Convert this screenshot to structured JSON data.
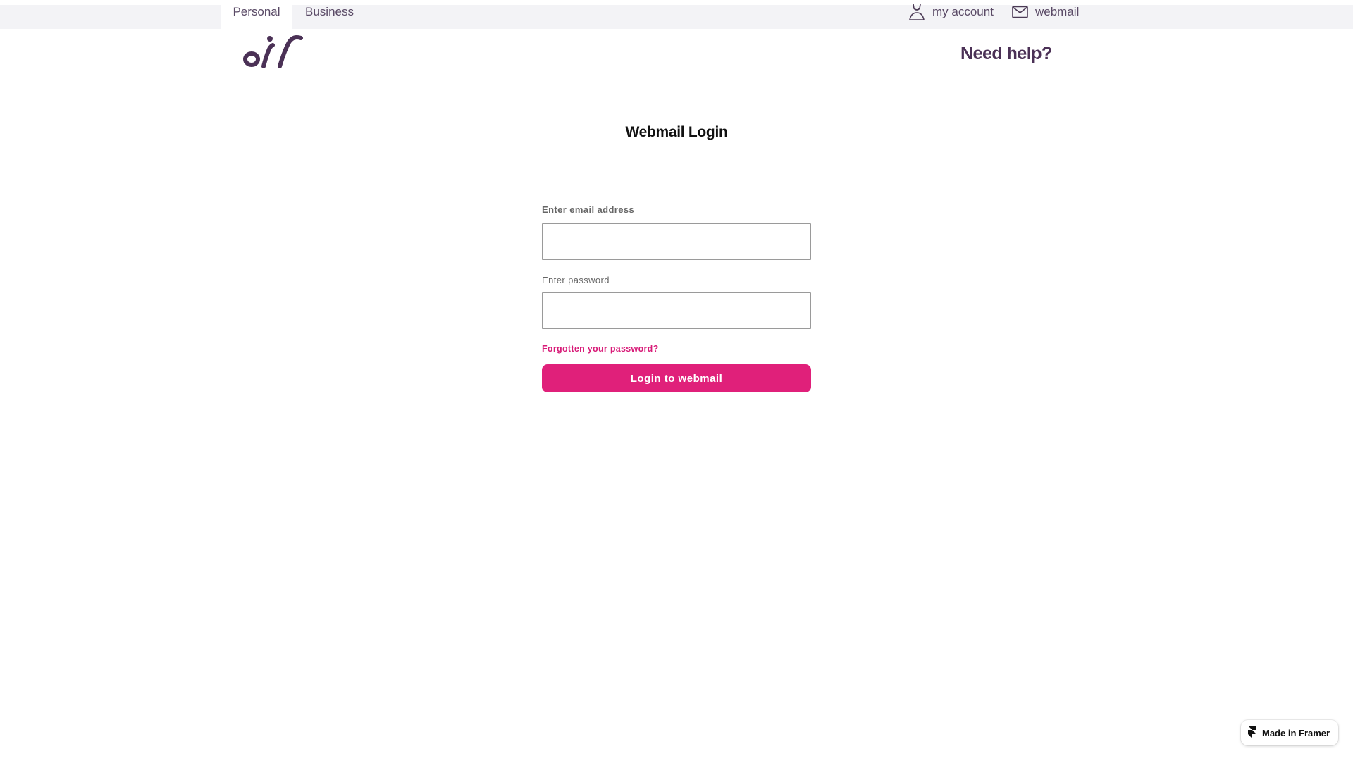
{
  "top_nav": {
    "tabs": [
      {
        "label": "Personal",
        "active": true
      },
      {
        "label": "Business",
        "active": false
      }
    ],
    "my_account_label": "my account",
    "webmail_label": "webmail",
    "icons": [
      "person-icon",
      "mail-icon"
    ]
  },
  "header": {
    "logo_icon": "eir-logo",
    "need_help_label": "Need help?"
  },
  "main": {
    "title": "Webmail Login",
    "email_label": "Enter email address",
    "email_value": "",
    "password_label": "Enter password",
    "password_value": "",
    "forgot_password_label": "Forgotten your password?",
    "login_button_label": "Login to webmail"
  },
  "badge": {
    "label": "Made in Framer",
    "icon": "framer-icon"
  },
  "colors": {
    "accent": "#e0207a",
    "brand_purple": "#4b3156",
    "topbar_bg": "#f3f3f6"
  }
}
